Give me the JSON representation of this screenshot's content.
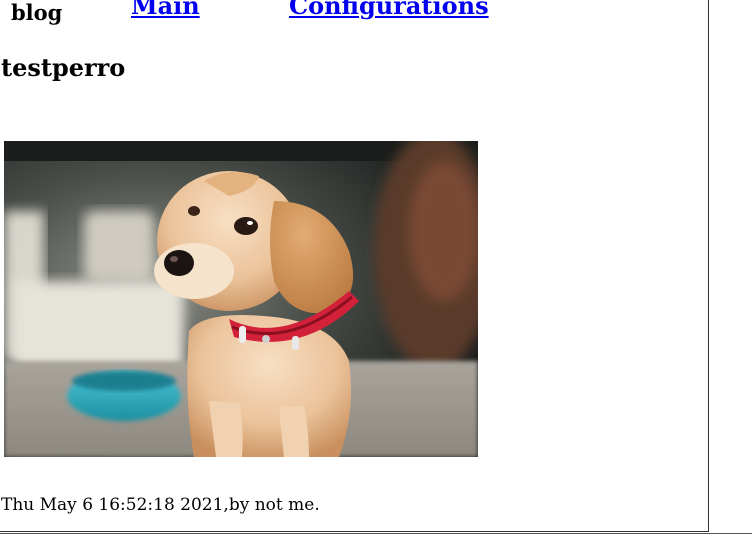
{
  "nav": {
    "brand": "blog",
    "links": [
      {
        "label": "Main"
      },
      {
        "label": "Configurations"
      }
    ]
  },
  "post": {
    "title": "testperro",
    "image": {
      "icon": "puppy-photo"
    },
    "meta": "Thu May 6 16:52:18 2021,by not me."
  },
  "colors": {
    "link": "#0000ee",
    "text": "#000000",
    "collar": "#d4213a",
    "bowl": "#2fb3c4"
  }
}
